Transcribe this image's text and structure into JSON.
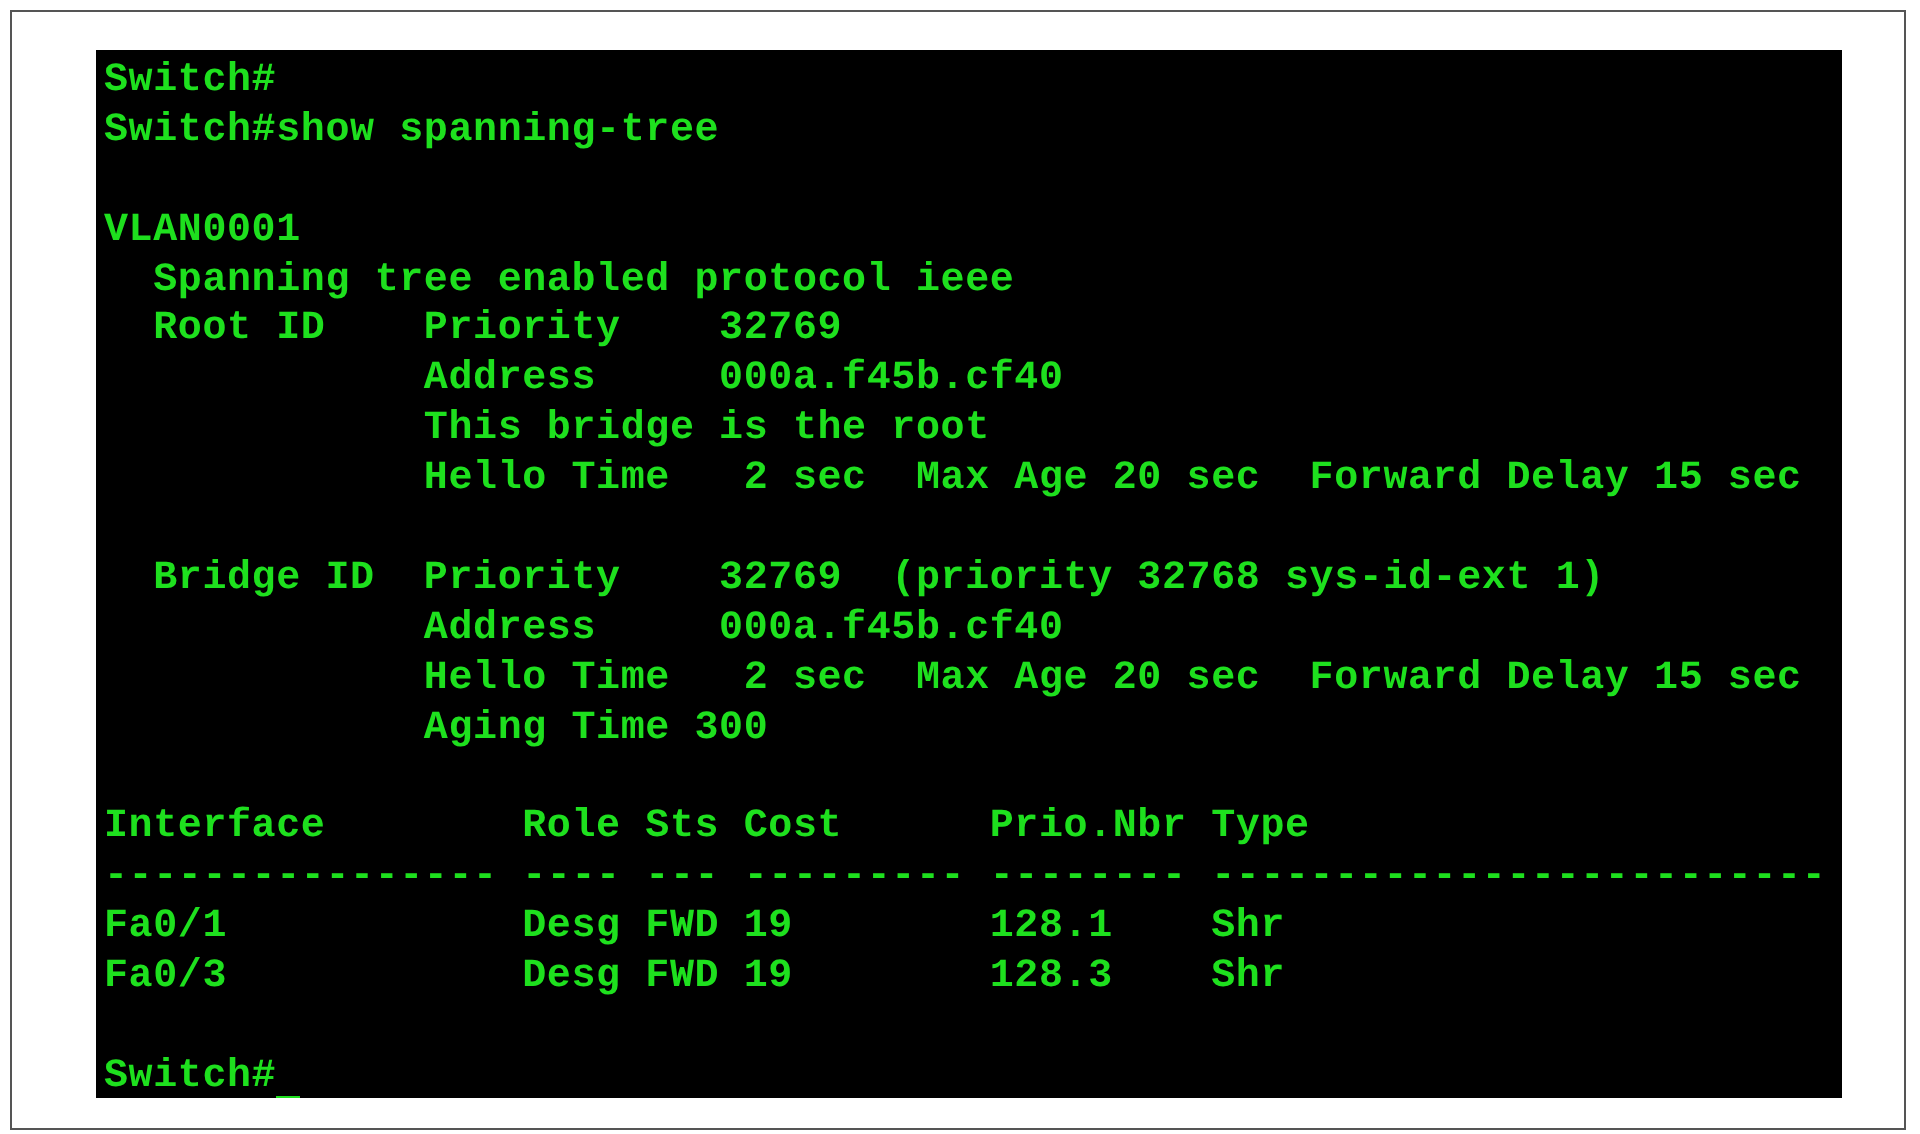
{
  "terminal": {
    "lines": [
      {
        "kind": "text",
        "text": "Switch#"
      },
      {
        "kind": "text",
        "text": "Switch#show spanning-tree"
      },
      {
        "kind": "blank"
      },
      {
        "kind": "text",
        "text": "VLAN0001"
      },
      {
        "kind": "text",
        "text": "  Spanning tree enabled protocol ieee"
      },
      {
        "kind": "text",
        "text": "  Root ID    Priority    32769"
      },
      {
        "kind": "text",
        "text": "             Address     000a.f45b.cf40"
      },
      {
        "kind": "text",
        "text": "             This bridge is the root"
      },
      {
        "kind": "text",
        "text": "             Hello Time   2 sec  Max Age 20 sec  Forward Delay 15 sec"
      },
      {
        "kind": "blank"
      },
      {
        "kind": "text",
        "text": "  Bridge ID  Priority    32769  (priority 32768 sys-id-ext 1)"
      },
      {
        "kind": "text",
        "text": "             Address     000a.f45b.cf40"
      },
      {
        "kind": "text",
        "text": "             Hello Time   2 sec  Max Age 20 sec  Forward Delay 15 sec"
      },
      {
        "kind": "text",
        "text": "             Aging Time 300"
      },
      {
        "kind": "blank"
      },
      {
        "kind": "text",
        "text": "Interface        Role Sts Cost      Prio.Nbr Type"
      },
      {
        "kind": "text",
        "text": "---------------- ---- --- --------- -------- -------------------------"
      },
      {
        "kind": "text",
        "text": "Fa0/1            Desg FWD 19        128.1    Shr"
      },
      {
        "kind": "text",
        "text": "Fa0/3            Desg FWD 19        128.3    Shr"
      },
      {
        "kind": "blank"
      },
      {
        "kind": "prompt",
        "text": "Switch#",
        "cursor": true
      }
    ]
  }
}
